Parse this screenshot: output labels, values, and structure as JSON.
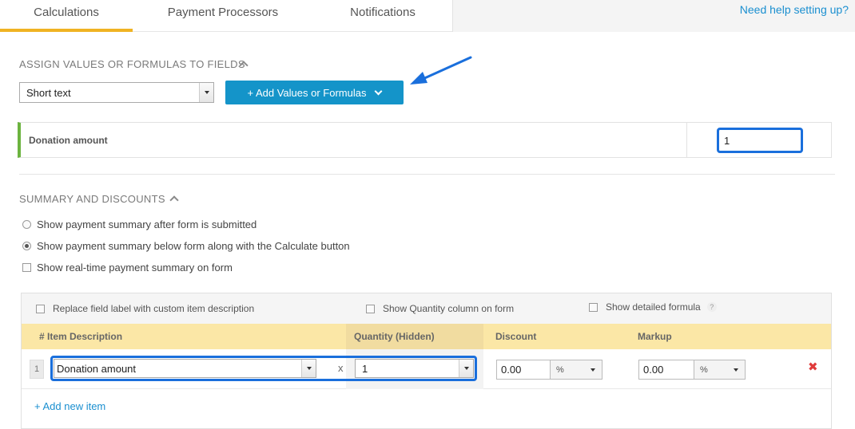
{
  "tabs": {
    "items": [
      {
        "label": "Calculations"
      },
      {
        "label": "Payment Processors"
      },
      {
        "label": "Notifications"
      }
    ],
    "help_link": "Need help setting up?"
  },
  "assign": {
    "heading": "ASSIGN VALUES OR FORMULAS TO FIELDS",
    "field_type_select": "Short text",
    "add_button": "+ Add Values or Formulas",
    "field_label": "Donation amount",
    "field_value": "1"
  },
  "summary": {
    "heading": "SUMMARY AND DISCOUNTS",
    "options": [
      {
        "label": "Show payment summary after form is submitted",
        "selected": false
      },
      {
        "label": "Show payment summary below form along with the Calculate button",
        "selected": true
      },
      {
        "label": "Show real-time payment summary on form",
        "checked": false
      }
    ]
  },
  "table": {
    "options": {
      "replace_label": "Replace field label with custom item description",
      "show_quantity": "Show Quantity column on form",
      "show_formula": "Show detailed formula",
      "help": "?"
    },
    "headers": {
      "item": "# Item Description",
      "quantity": "Quantity  (Hidden)",
      "discount": "Discount",
      "markup": "Markup"
    },
    "rows": [
      {
        "num": "1",
        "item": "Donation amount",
        "times": "x",
        "quantity": "1",
        "discount": "0.00",
        "discount_unit": "%",
        "markup": "0.00",
        "markup_unit": "%"
      }
    ],
    "add_item": "+ Add new item"
  },
  "colors": {
    "accent_tab": "#f0b323",
    "button_blue": "#1494c9",
    "highlight_blue": "#1a6fdc",
    "field_green": "#6cb33f",
    "header_yellow": "#fbe7a6",
    "delete_red": "#e03b3b",
    "annotation_arrow": "#1a6fdc"
  }
}
